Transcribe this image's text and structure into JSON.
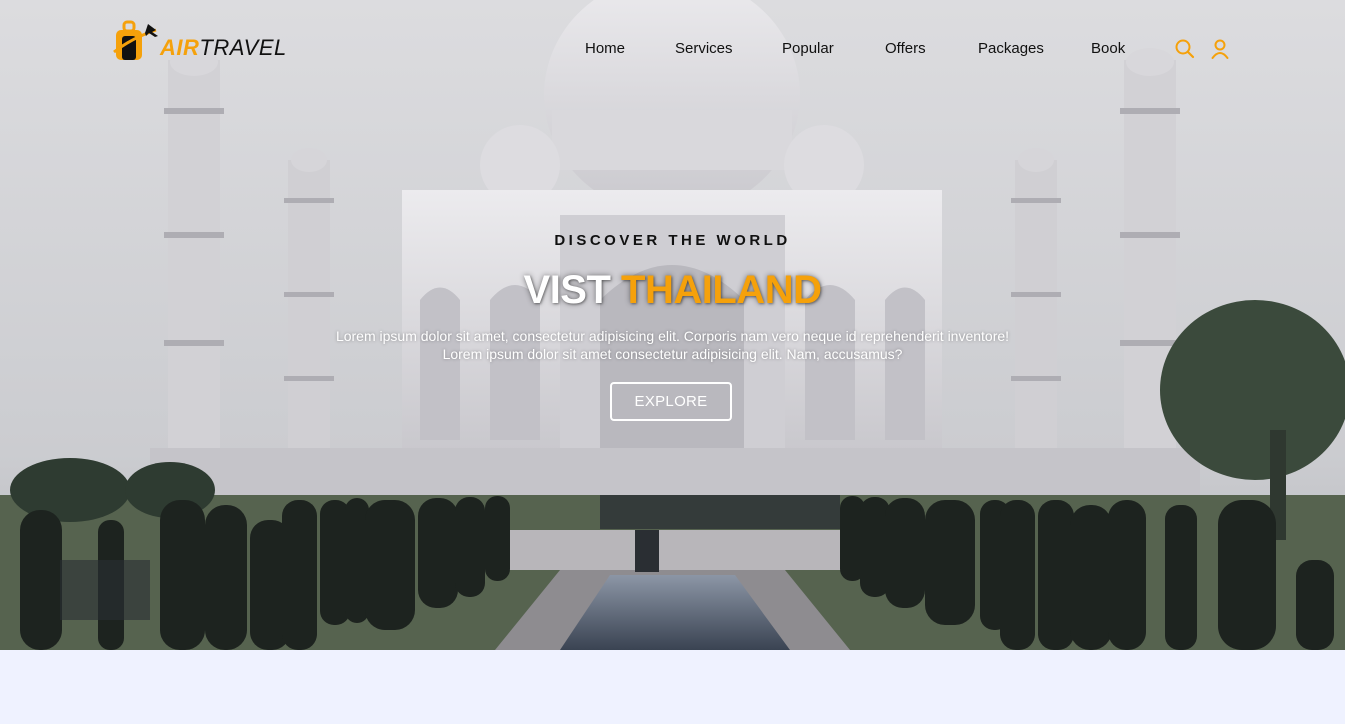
{
  "brand": {
    "part1": "AIR",
    "part2": "TRAVEL",
    "accent_color": "#f5a10b"
  },
  "nav": {
    "links": [
      "Home",
      "Services",
      "Popular",
      "Offers",
      "Packages",
      "Book"
    ],
    "icons": [
      "search-icon",
      "user-icon"
    ]
  },
  "hero": {
    "subtitle": "DISCOVER THE WORLD",
    "headline_word1": "VIST",
    "headline_word2": "THAILAND",
    "description_line1": "Lorem ipsum dolor sit amet, consectetur adipisicing elit. Corporis nam vero neque id reprehenderit inventore!",
    "description_line2": "Lorem ipsum dolor sit amet consectetur adipisicing elit. Nam, accusamus?",
    "button_label": "EXPLORE",
    "background_image": "Taj Mahal with garden and reflecting pool"
  },
  "colors": {
    "accent": "#f5a10b",
    "text_dark": "#111111",
    "page_bg": "#eff2ff"
  }
}
